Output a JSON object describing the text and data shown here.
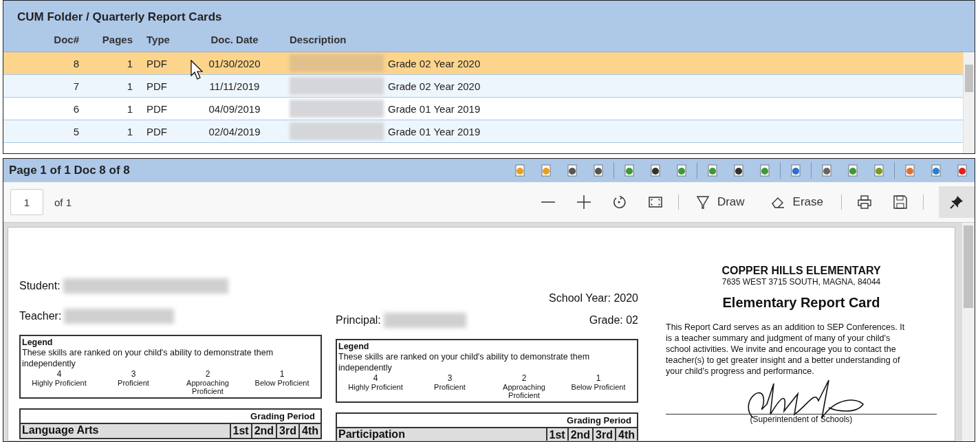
{
  "panel": {
    "title": "CUM Folder / Quarterly Report Cards",
    "columns": [
      "Doc#",
      "Pages",
      "Type",
      "Doc. Date",
      "Description"
    ],
    "rows": [
      {
        "doc": "8",
        "pages": "1",
        "type": "PDF",
        "date": "01/30/2020",
        "description": "Grade 02 Year 2020",
        "selected": true
      },
      {
        "doc": "7",
        "pages": "1",
        "type": "PDF",
        "date": "11/11/2019",
        "description": "Grade 02 Year 2020",
        "selected": false
      },
      {
        "doc": "6",
        "pages": "1",
        "type": "PDF",
        "date": "04/09/2019",
        "description": "Grade 01 Year 2019",
        "selected": false
      },
      {
        "doc": "5",
        "pages": "1",
        "type": "PDF",
        "date": "02/04/2019",
        "description": "Grade 01 Year 2019",
        "selected": false
      }
    ]
  },
  "viewer": {
    "title": "Page 1 of 1 Doc 8 of 8",
    "page_field": "1",
    "page_total": "of 1",
    "draw": "Draw",
    "erase": "Erase",
    "pinned": true
  },
  "document": {
    "school": "COPPER HILLS ELEMENTARY",
    "address": "7635 WEST 3715 SOUTH, MAGNA, 84044",
    "title": "Elementary Report Card",
    "intro": "This Report Card serves as an addition to SEP Conferences. It is a teacher summary and judgment of many of your child's school activities. We invite and encourage you to contact the teacher(s) to get greater insight and a better understanding of your child's progress and performance.",
    "signature_caption": "(Superintendent of Schools)",
    "student_label": "Student:",
    "teacher_label": "Teacher:",
    "principal_label": "Principal:",
    "school_year": "School Year: 2020",
    "grade": "Grade: 02",
    "legends": [
      {
        "title": "Legend",
        "text": "These skills are ranked on your child's ability to demonstrate them independently",
        "scale": [
          {
            "value": "4",
            "label": "Highly Proficient"
          },
          {
            "value": "3",
            "label": "Proficient"
          },
          {
            "value": "2",
            "label": "Approaching Proficient"
          },
          {
            "value": "1",
            "label": "Below Proficient"
          }
        ]
      },
      {
        "title": "Legend",
        "text": "These skills are ranked on your child's ability to demonstrate them independently",
        "scale": [
          {
            "value": "4",
            "label": "Highly Proficient"
          },
          {
            "value": "3",
            "label": "Proficient"
          },
          {
            "value": "2",
            "label": "Approaching Proficient"
          },
          {
            "value": "1",
            "label": "Below Proficient"
          }
        ]
      }
    ],
    "tables": [
      {
        "caption": "Grading Period",
        "subject": "Language Arts",
        "periods": [
          "1st",
          "2nd",
          "3rd",
          "4th"
        ]
      },
      {
        "caption": "Grading Period",
        "subject": "Participation",
        "periods": [
          "1st",
          "2nd",
          "3rd",
          "4th"
        ]
      }
    ]
  }
}
